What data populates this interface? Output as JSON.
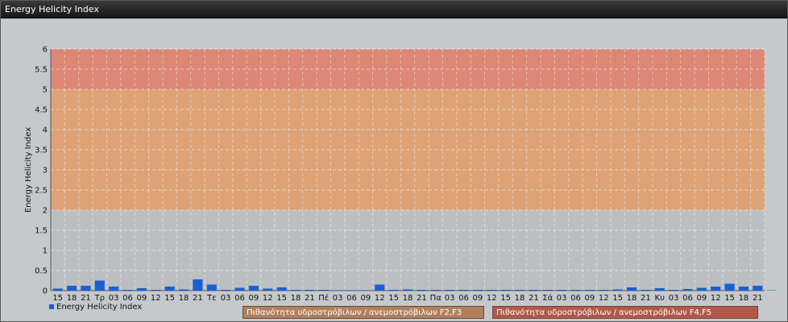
{
  "window": {
    "title": "Energy Helicity Index"
  },
  "legend": {
    "series_label": "Energy Helicity Index"
  },
  "zones": [
    {
      "label": "Πιθανότητα υδροστρόβιλων / ανεμοστρόβιλων F2,F3",
      "from": 2,
      "to": 5,
      "color": "#e0a070"
    },
    {
      "label": "Πιθανότητα υδροστρόβιλων / ανεμοστρόβιλων F4,F5",
      "from": 5,
      "to": 6,
      "color": "#e08270"
    }
  ],
  "chart_data": {
    "type": "bar",
    "ylabel": "Energy Helicity Index",
    "ylim": [
      0,
      6
    ],
    "yticks": [
      "0",
      "0.5",
      "1",
      "1.5",
      "2",
      "2.5",
      "3",
      "3.5",
      "4",
      "4.5",
      "5",
      "5.5",
      "6"
    ],
    "grid": true,
    "bar_color": "#1a5ed8",
    "categories": [
      "15",
      "18",
      "21",
      "Τρ",
      "03",
      "06",
      "09",
      "12",
      "15",
      "18",
      "21",
      "Τε",
      "03",
      "06",
      "09",
      "12",
      "15",
      "18",
      "21",
      "Πέ",
      "03",
      "06",
      "09",
      "12",
      "15",
      "18",
      "21",
      "Πα",
      "03",
      "06",
      "09",
      "12",
      "15",
      "18",
      "21",
      "Σά",
      "03",
      "06",
      "09",
      "12",
      "15",
      "18",
      "21",
      "Κυ",
      "03",
      "06",
      "09",
      "12",
      "15",
      "18",
      "21"
    ],
    "series": [
      {
        "name": "Energy Helicity Index",
        "values": [
          0.05,
          0.12,
          0.12,
          0.25,
          0.1,
          0.02,
          0.06,
          0.02,
          0.1,
          0.03,
          0.28,
          0.15,
          0.02,
          0.07,
          0.12,
          0.05,
          0.08,
          0.02,
          0.02,
          0.02,
          0.01,
          0.01,
          0.01,
          0.15,
          0.02,
          0.03,
          0.02,
          0.02,
          0.02,
          0.02,
          0.02,
          0.02,
          0.02,
          0.02,
          0.02,
          0.02,
          0.02,
          0.02,
          0.02,
          0.02,
          0.03,
          0.08,
          0.02,
          0.06,
          0.02,
          0.04,
          0.07,
          0.1,
          0.17,
          0.1,
          0.12,
          0.01
        ]
      }
    ]
  }
}
